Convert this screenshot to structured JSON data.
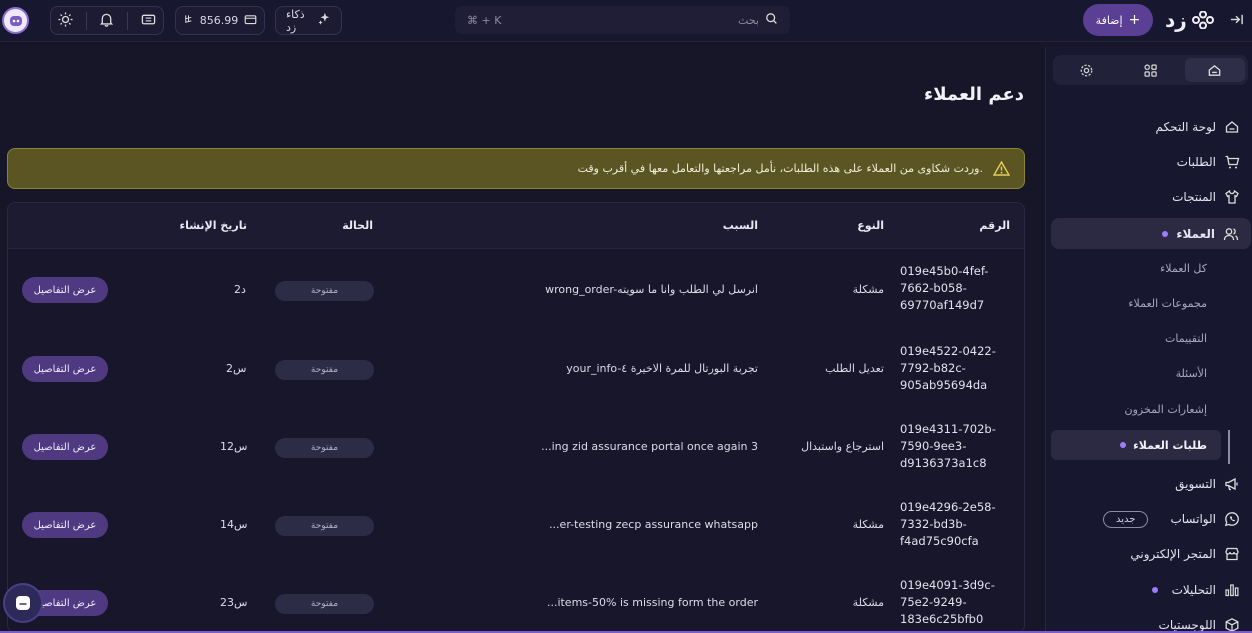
{
  "topbar": {
    "search_placeholder": "بحث",
    "search_shortcut": "⌘ + K",
    "add_label": "إضافة",
    "logo_text": "زد",
    "ai_label": "ذكاء زد",
    "balance": "856.99"
  },
  "sidebar": {
    "items": [
      {
        "label": "لوحة التحكم"
      },
      {
        "label": "الطلبات"
      },
      {
        "label": "المنتجات"
      },
      {
        "label": "العملاء"
      },
      {
        "label": "التسويق"
      },
      {
        "label": "الواتساب"
      },
      {
        "label": "المتجر الإلكتروني"
      },
      {
        "label": "التحليلات"
      },
      {
        "label": "اللوجستيات"
      }
    ],
    "sub_items": [
      {
        "label": "كل العملاء"
      },
      {
        "label": "مجموعات العملاء"
      },
      {
        "label": "التقييمات"
      },
      {
        "label": "الأسئلة"
      },
      {
        "label": "إشعارات المخزون"
      },
      {
        "label": "طلبات العملاء"
      }
    ],
    "new_badge": "جديد"
  },
  "page": {
    "title": "دعم العملاء",
    "alert_text": "وردت شكاوى من العملاء على هذه الطلبات، نأمل مراجعتها والتعامل معها في أقرب وقت."
  },
  "table": {
    "headers": {
      "number": "الرقم",
      "type": "النوع",
      "reason": "السبب",
      "status": "الحالة",
      "created": "تاريخ الإنشاء"
    },
    "rows": [
      {
        "id_l1": "019e45b0-4fef-",
        "id_l2": "7662-b058-",
        "id_l3": "69770af149d7",
        "type": "مشكلة",
        "reason": "wrong_order-انرسل لي الطلب وانا ما سويته",
        "status": "مفتوحة",
        "created": "2د",
        "action": "عرض التفاصيل"
      },
      {
        "id_l1": "019e4522-0422-",
        "id_l2": "7792-b82c-",
        "id_l3": "905ab95694da",
        "type": "تعديل الطلب",
        "reason": "your_info-تجربة البورتال للمرة الاخيرة ٤",
        "status": "مفتوحة",
        "created": "2س",
        "action": "عرض التفاصيل"
      },
      {
        "id_l1": "019e4311-702b-",
        "id_l2": "7590-9ee3-",
        "id_l3": "d9136373a1c8",
        "type": "استرجاع واستبدال",
        "reason": "...ing zid assurance portal once again 3",
        "status": "مفتوحة",
        "created": "12س",
        "action": "عرض التفاصيل"
      },
      {
        "id_l1": "019e4296-2e58-",
        "id_l2": "7332-bd3b-",
        "id_l3": "f4ad75c90cfa",
        "type": "مشكلة",
        "reason": "...er-testing zecp assurance whatsapp",
        "status": "مفتوحة",
        "created": "14س",
        "action": "عرض التفاصيل"
      },
      {
        "id_l1": "019e4091-3d9c-",
        "id_l2": "75e2-9249-",
        "id_l3": "183e6c25bfb0",
        "type": "مشكلة",
        "reason": "...items-50% is missing form the order",
        "status": "مفتوحة",
        "created": "23س",
        "action": "عرض التفاصيل"
      }
    ]
  },
  "icons": [
    "collapse-icon",
    "logo-icon",
    "plus-icon",
    "search-icon",
    "sparkle-icon",
    "wallet-icon",
    "riyal-icon",
    "ticket-icon",
    "bell-icon",
    "sun-icon",
    "home-icon",
    "apps-icon",
    "gear-icon",
    "cart-icon",
    "shirt-icon",
    "users-icon",
    "megaphone-icon",
    "whatsapp-icon",
    "store-icon",
    "chart-icon",
    "box-icon",
    "warning-icon",
    "chat-icon"
  ],
  "colors": {
    "accent": "#5a3f94",
    "alert_bg": "#5a5523",
    "background": "#171629"
  }
}
